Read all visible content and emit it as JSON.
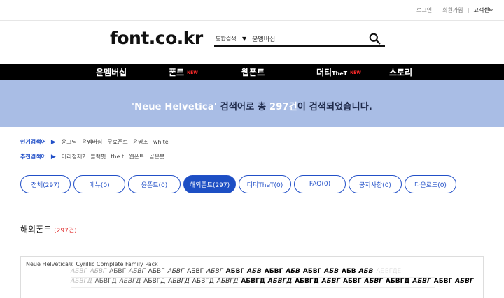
{
  "top_links": [
    "로그인",
    "회원가입",
    "고객센터"
  ],
  "logo": "font.co.kr",
  "search": {
    "scope": "통합검색",
    "scope_arrow": "▼",
    "value": "윤멤버십"
  },
  "gnb": [
    {
      "label": "윤멤버십",
      "badge": ""
    },
    {
      "label": "폰트",
      "badge": "NEW"
    },
    {
      "label": "웹폰트",
      "badge": ""
    },
    {
      "label": "더티",
      "sub": "TheT",
      "badge": "NEW"
    },
    {
      "label": "스토리",
      "badge": ""
    }
  ],
  "banner": {
    "query": "'Neue Helvetica'",
    "mid": " 검색어로 총 ",
    "count": "297건",
    "tail": "이 검색되었습니다."
  },
  "popular": {
    "label": "인기검색어",
    "items": [
      "윤고딕",
      "윤멤버십",
      "무료폰트",
      "윤명조",
      "white"
    ]
  },
  "recommended": {
    "label": "추천검색어",
    "items": [
      "머리정체2",
      "블랙핏",
      "the t",
      "웹폰트",
      "곧은붓"
    ]
  },
  "tabs": [
    {
      "label": "전체(297)",
      "active": false
    },
    {
      "label": "메뉴(0)",
      "active": false
    },
    {
      "label": "윤폰트(0)",
      "active": false
    },
    {
      "label": "해외폰트(297)",
      "active": true
    },
    {
      "label": "더티TheT(0)",
      "active": false
    },
    {
      "label": "FAQ(0)",
      "active": false
    },
    {
      "label": "공지사항(0)",
      "active": false
    },
    {
      "label": "다운로드(0)",
      "active": false
    }
  ],
  "section": {
    "title": "해외폰트",
    "count": "(297건)"
  },
  "result": {
    "title": "Neue Helvetica® Cyrillic Complete Family Pack",
    "row1": [
      "АБВГ",
      "АБВГ",
      "АБВГ",
      "АБВГ",
      "АБВГ",
      "АБВГ",
      "АБВГ",
      "АБВГ",
      "АБВГ",
      "АБВ",
      "АБВГ",
      "АБВ",
      "АБВГ",
      "АБВ",
      "АБВ",
      "АБВ",
      "АБВГДЕ"
    ],
    "row2": [
      "АБВГД",
      "АБВГД",
      "АБВГД",
      "АБВГД",
      "АБВГД",
      "АБВГД",
      "АБВГД",
      "АБВГД",
      "АБВГД",
      "АБВГД",
      "АБВГ",
      "АБВГ",
      "АБВГ",
      "АБВГД",
      "АБВГ",
      "АБВГ",
      "АБВГ"
    ]
  },
  "colors": {
    "accent": "#1d4fc4",
    "banner_bg": "#a9bde5",
    "new_badge": "#ff2a2a"
  }
}
